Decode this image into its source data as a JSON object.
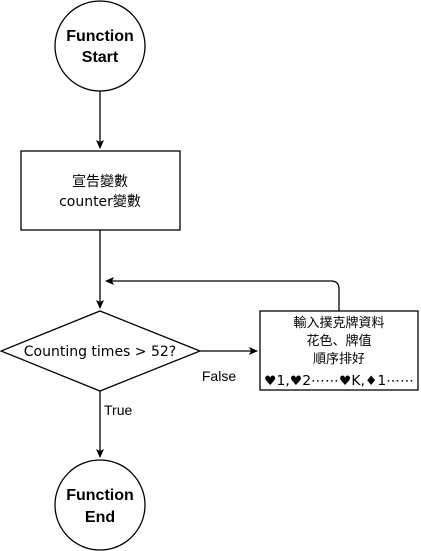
{
  "start_node": {
    "line1": "Function",
    "line2": "Start"
  },
  "declare_node": {
    "line1": "宣告變數",
    "line2": "counter變數"
  },
  "decision_node": {
    "label": "Counting times > 52?"
  },
  "input_node": {
    "line1": "輸入撲克牌資料",
    "line2": "花色、牌值",
    "line3": "順序排好",
    "line4": "♥1,♥2⋯⋯♥K,♦1⋯⋯"
  },
  "edge_labels": {
    "false_label": "False",
    "true_label": "True"
  },
  "end_node": {
    "line1": "Function",
    "line2": "End"
  }
}
